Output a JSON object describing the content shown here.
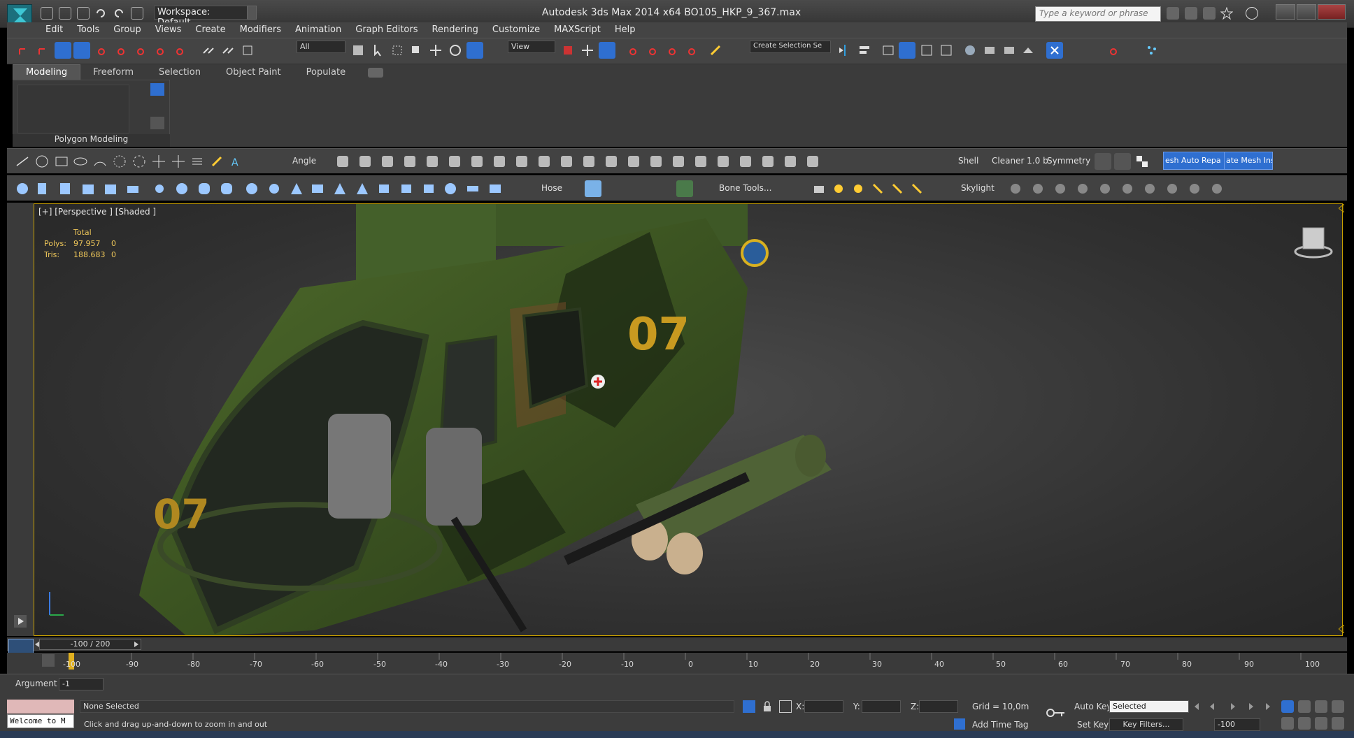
{
  "titlebar": {
    "workspace": "Workspace: Default",
    "app_title": "Autodesk 3ds Max  2014 x64     BO105_HKP_9_367.max",
    "search_placeholder": "Type a keyword or phrase"
  },
  "menu": [
    "Edit",
    "Tools",
    "Group",
    "Views",
    "Create",
    "Modifiers",
    "Animation",
    "Graph Editors",
    "Rendering",
    "Customize",
    "MAXScript",
    "Help"
  ],
  "main_toolbar": {
    "filter_value": "All",
    "ref_coord_value": "View",
    "named_selection_placeholder": "Create Selection Se"
  },
  "ribbon": {
    "tabs": [
      "Modeling",
      "Freeform",
      "Selection",
      "Object Paint",
      "Populate"
    ],
    "active_tab": "Modeling",
    "panel_label": "Polygon Modeling"
  },
  "command_row1": {
    "angle": "Angle",
    "shell": "Shell",
    "cleaner": "Cleaner 1.0 b",
    "symmetry": "Symmetry",
    "mesh_auto": "esh Auto Repa",
    "mesh_insp": "ate Mesh Insp"
  },
  "command_row2": {
    "hose": "Hose",
    "bone_tools": "Bone Tools...",
    "skylight": "Skylight"
  },
  "viewport": {
    "label": "[+] [Perspective ] [Shaded ]",
    "stats": {
      "total": "Total",
      "polys_label": "Polys:",
      "polys_value": "97.957",
      "polys_sel": "0",
      "tris_label": "Tris:",
      "tris_value": "188.683",
      "tris_sel": "0"
    },
    "livery_number": "07"
  },
  "timeline": {
    "frame_display": "-100 / 200",
    "ticks": [
      "-100",
      "-90",
      "-80",
      "-70",
      "-60",
      "-50",
      "-40",
      "-30",
      "-20",
      "-10",
      "0",
      "10",
      "20",
      "30",
      "40",
      "50",
      "60",
      "70",
      "80",
      "90",
      "100"
    ]
  },
  "status": {
    "argument_label": "Argument",
    "argument_value": "-1",
    "listener_text": "Welcome to M",
    "selection_status": "None Selected",
    "prompt": "Click and drag up-and-down to zoom in and out",
    "x_label": "X:",
    "y_label": "Y:",
    "z_label": "Z:",
    "grid": "Grid = 10,0m",
    "add_time_tag": "Add Time Tag",
    "auto_key": "Auto Key",
    "selected": "Selected",
    "set_key": "Set Key",
    "key_filters": "Key Filters...",
    "current_frame": "-100"
  },
  "colors": {
    "viewport_border": "#c8a000",
    "stats_text": "#f0c85a",
    "active_blue": "#2f6fd0"
  }
}
